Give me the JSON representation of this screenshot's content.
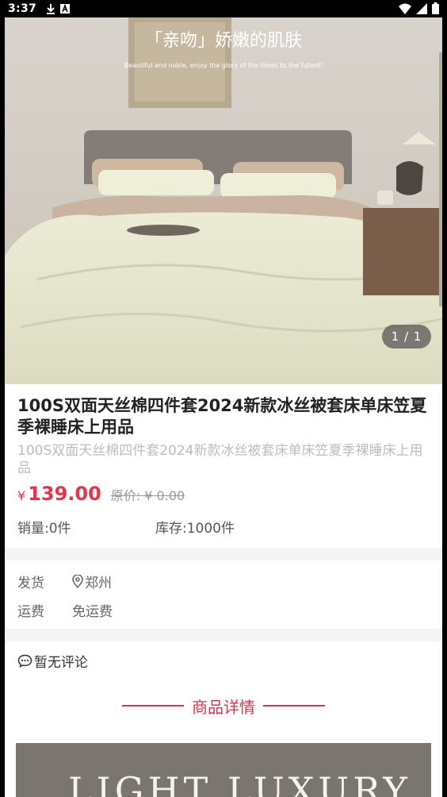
{
  "status_bar": {
    "time": "3:37"
  },
  "gallery": {
    "banner_text": "「亲吻」娇嫩的肌肤",
    "banner_subtext": "Beautiful and noble, enjoy the glory of the times to the fullest!",
    "counter": "1 / 1"
  },
  "product": {
    "title": "100S双面天丝棉四件套2024新款冰丝被套床单床笠夏季裸睡床上用品",
    "subtitle": "100S双面天丝棉四件套2024新款冰丝被套床单床笠夏季裸睡床上用品",
    "currency": "¥",
    "price": "139.00",
    "original_price": "原价: ¥ 0.00",
    "sales": "销量:0件",
    "stock": "库存:1000件"
  },
  "shipping": {
    "from_label": "发货",
    "from_value": "郑州",
    "fee_label": "运费",
    "fee_value": "免运费"
  },
  "reviews": {
    "text": "暂无评论"
  },
  "detail": {
    "heading": "商品详情",
    "image_text": "LIGHT LUXURY"
  },
  "colors": {
    "accent": "#e1354a",
    "heading": "#d2344c"
  }
}
